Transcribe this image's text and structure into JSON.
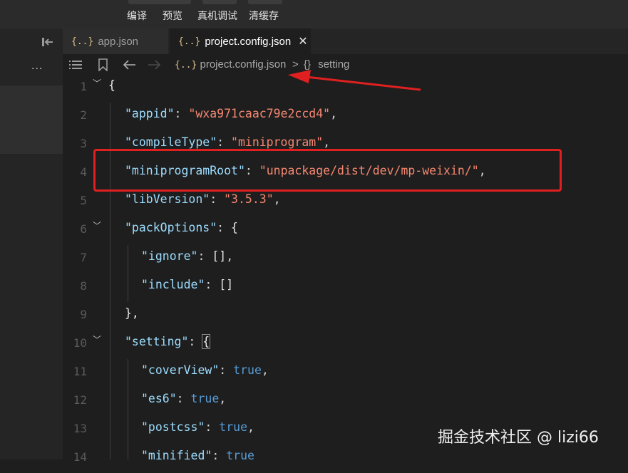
{
  "toolbar": {
    "buttons": [
      "编译",
      "预览",
      "真机调试",
      "清缓存"
    ]
  },
  "tabs": [
    {
      "icon": "{..}",
      "label": "app.json",
      "active": false
    },
    {
      "icon": "{..}",
      "label": "project.config.json",
      "active": true,
      "close": "✕"
    }
  ],
  "sidepanel": {
    "more": "..."
  },
  "breadcrumb": {
    "file_icon": "{..}",
    "file": "project.config.json",
    "separator": ">",
    "obj_icon": "{}",
    "section": "setting"
  },
  "editor": {
    "line_numbers": [
      "1",
      "2",
      "3",
      "4",
      "5",
      "6",
      "7",
      "8",
      "9",
      "10",
      "11",
      "12",
      "13",
      "14"
    ],
    "lines": {
      "l1": "{",
      "l2_key": "\"appid\"",
      "l2_val": "\"wxa971caac79e2ccd4\"",
      "l3_key": "\"compileType\"",
      "l3_val": "\"miniprogram\"",
      "l4_key": "\"miniprogramRoot\"",
      "l4_val": "\"unpackage/dist/dev/mp-weixin/\"",
      "l5_key": "\"libVersion\"",
      "l5_val": "\"3.5.3\"",
      "l6_key": "\"packOptions\"",
      "l6_brace": "{",
      "l7_key": "\"ignore\"",
      "l7_val": "[]",
      "l8_key": "\"include\"",
      "l8_val": "[]",
      "l9": "},",
      "l10_key": "\"setting\"",
      "l10_brace": "{",
      "l11_key": "\"coverView\"",
      "l11_val": "true",
      "l12_key": "\"es6\"",
      "l12_val": "true",
      "l13_key": "\"postcss\"",
      "l13_val": "true",
      "l14_key": "\"minified\"",
      "l14_val": "true"
    }
  },
  "watermark": "掘金技术社区 @ lizi66",
  "colors": {
    "annotation": "#e02020",
    "string": "#f48771",
    "key": "#9cdcfe",
    "bool": "#569cd6"
  }
}
